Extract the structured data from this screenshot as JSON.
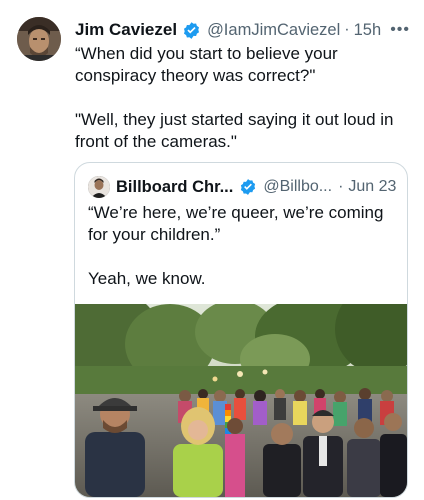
{
  "tweet": {
    "author_name": "Jim Caviezel",
    "handle": "@IamJimCaviezel",
    "separator": "·",
    "time": "15h",
    "more_label": "•••",
    "text_line1": "“When did you start to believe your conspiracy theory was correct?\"",
    "text_line2": "\"Well, they just started saying it out loud in front of the cameras.\""
  },
  "quote": {
    "author_name": "Billboard Chr...",
    "handle": "@Billbo...",
    "separator": "·",
    "time": "Jun 23",
    "text_line1": "“We’re here, we’re queer, we’re coming for your children.”",
    "text_line2": "Yeah, we know."
  },
  "colors": {
    "verified_blue": "#1d9bf0",
    "muted_text": "#536471",
    "border": "#cfd9de"
  },
  "icons": {
    "verified": "verified-badge-icon",
    "more": "more-horizontal-icon"
  }
}
